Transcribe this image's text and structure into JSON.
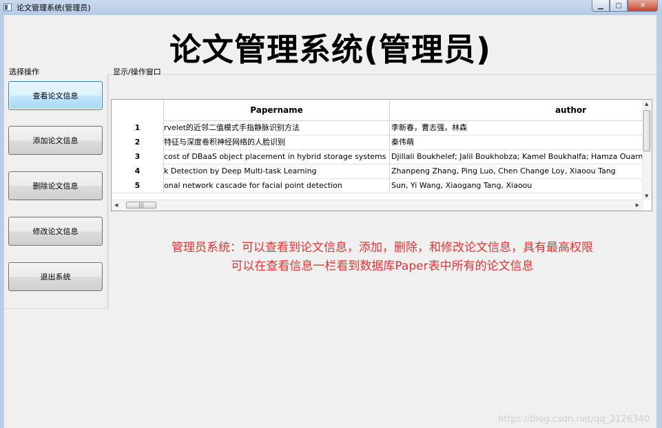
{
  "window": {
    "title": "论文管理系统(管理员)"
  },
  "header": {
    "title": "论文管理系统(管理员)"
  },
  "operations": {
    "group_label": "选择操作",
    "buttons": [
      {
        "label": "查看论文信息",
        "active": true
      },
      {
        "label": "添加论文信息"
      },
      {
        "label": "删除论文信息"
      },
      {
        "label": "修改论文信息"
      },
      {
        "label": "退出系统"
      }
    ]
  },
  "view": {
    "group_label": "显示/操作窗口"
  },
  "table": {
    "columns": [
      "Papername",
      "author"
    ],
    "rows": [
      {
        "num": "1",
        "papername": "rvelet的近邻二值模式手指静脉识别方法",
        "author": "李新春，曹志强，林森"
      },
      {
        "num": "2",
        "papername": "特征与深度卷积神经网络的人脸识别",
        "author": "秦伟萌"
      },
      {
        "num": "3",
        "papername": "cost of DBaaS object placement in hybrid storage systems",
        "author": "Djillali Boukhelef; Jalil Boukhobza; Kamel Boukhalfa; Hamza Ouarne"
      },
      {
        "num": "4",
        "papername": "k Detection by Deep Multi-task Learning",
        "author": "Zhanpeng Zhang, Ping Luo, Chen Change Loy, Xiaoou Tang"
      },
      {
        "num": "5",
        "papername": "onal network cascade for facial point detection",
        "author": "Sun, Yi  Wang, Xiaogang   Tang, Xiaoou"
      }
    ],
    "hscroll_thumb": "|||"
  },
  "description": {
    "line1": "管理员系统：可以查看到论文信息，添加，删除，和修改论文信息，具有最高权限",
    "line2": "可以在查看信息一栏看到数据库Paper表中所有的论文信息"
  },
  "watermark": "https://blog.csdn.net/qq_3126340",
  "colors": {
    "description": "#e53333",
    "active_button": "#bee6fd"
  }
}
